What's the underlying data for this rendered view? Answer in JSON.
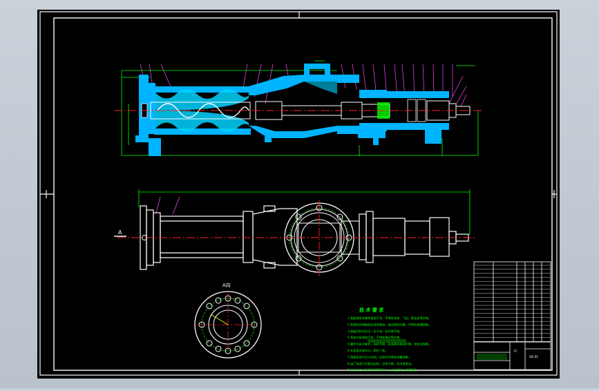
{
  "drawing": {
    "colors": {
      "background": "#c4ccd4",
      "sheet": "#000000",
      "frame": "#ffffff",
      "part": "#ffffff",
      "section": "#00b4ff",
      "hatch": "#00d2ff",
      "dimension": "#00ff00",
      "centerline": "#ff2020",
      "leader": "#ff4aff",
      "note_text": "#00ff00",
      "highlight": "#ffff00"
    },
    "view_label_a": "A",
    "view_label_a_direction": "A向",
    "tech_title": "技 术 要 求",
    "tech_lines": [
      "1.装配前所有零件清洗干净，不得有毛刺、飞边、氧化皮等杂物。",
      "2.各密封件装配前必须浸透油，保证密封可靠，不得有泄漏现象。",
      "3.装配后转动灵活，无卡滞，无异常声响。",
      "4.泵体内部清理干净，不得有铸砂等杂物。",
      "5.螺杆与定子配合，运转平稳，各连接处紧固牢靠，无松动现象。",
      "6.外表面涂漆均匀，颜色一致。",
      "7.按规定进行压力试验，试验时不得有渗漏现象。",
      "8.出厂前进行空载试运转，运转平稳，无异常振动。",
      "9.未注尺寸公差按GB/T1804-m，未注形位公差按K级。"
    ],
    "title_block": {
      "drawing_number": "SB-01",
      "small_label": "FF"
    }
  }
}
